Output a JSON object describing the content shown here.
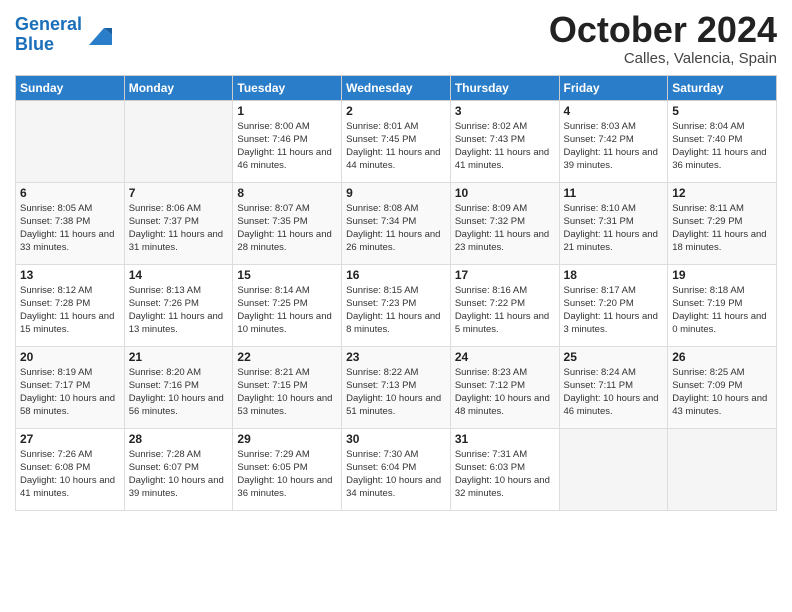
{
  "header": {
    "logo_line1": "General",
    "logo_line2": "Blue",
    "month": "October 2024",
    "location": "Calles, Valencia, Spain"
  },
  "days_of_week": [
    "Sunday",
    "Monday",
    "Tuesday",
    "Wednesday",
    "Thursday",
    "Friday",
    "Saturday"
  ],
  "weeks": [
    [
      {
        "day": "",
        "info": ""
      },
      {
        "day": "",
        "info": ""
      },
      {
        "day": "1",
        "info": "Sunrise: 8:00 AM\nSunset: 7:46 PM\nDaylight: 11 hours and 46 minutes."
      },
      {
        "day": "2",
        "info": "Sunrise: 8:01 AM\nSunset: 7:45 PM\nDaylight: 11 hours and 44 minutes."
      },
      {
        "day": "3",
        "info": "Sunrise: 8:02 AM\nSunset: 7:43 PM\nDaylight: 11 hours and 41 minutes."
      },
      {
        "day": "4",
        "info": "Sunrise: 8:03 AM\nSunset: 7:42 PM\nDaylight: 11 hours and 39 minutes."
      },
      {
        "day": "5",
        "info": "Sunrise: 8:04 AM\nSunset: 7:40 PM\nDaylight: 11 hours and 36 minutes."
      }
    ],
    [
      {
        "day": "6",
        "info": "Sunrise: 8:05 AM\nSunset: 7:38 PM\nDaylight: 11 hours and 33 minutes."
      },
      {
        "day": "7",
        "info": "Sunrise: 8:06 AM\nSunset: 7:37 PM\nDaylight: 11 hours and 31 minutes."
      },
      {
        "day": "8",
        "info": "Sunrise: 8:07 AM\nSunset: 7:35 PM\nDaylight: 11 hours and 28 minutes."
      },
      {
        "day": "9",
        "info": "Sunrise: 8:08 AM\nSunset: 7:34 PM\nDaylight: 11 hours and 26 minutes."
      },
      {
        "day": "10",
        "info": "Sunrise: 8:09 AM\nSunset: 7:32 PM\nDaylight: 11 hours and 23 minutes."
      },
      {
        "day": "11",
        "info": "Sunrise: 8:10 AM\nSunset: 7:31 PM\nDaylight: 11 hours and 21 minutes."
      },
      {
        "day": "12",
        "info": "Sunrise: 8:11 AM\nSunset: 7:29 PM\nDaylight: 11 hours and 18 minutes."
      }
    ],
    [
      {
        "day": "13",
        "info": "Sunrise: 8:12 AM\nSunset: 7:28 PM\nDaylight: 11 hours and 15 minutes."
      },
      {
        "day": "14",
        "info": "Sunrise: 8:13 AM\nSunset: 7:26 PM\nDaylight: 11 hours and 13 minutes."
      },
      {
        "day": "15",
        "info": "Sunrise: 8:14 AM\nSunset: 7:25 PM\nDaylight: 11 hours and 10 minutes."
      },
      {
        "day": "16",
        "info": "Sunrise: 8:15 AM\nSunset: 7:23 PM\nDaylight: 11 hours and 8 minutes."
      },
      {
        "day": "17",
        "info": "Sunrise: 8:16 AM\nSunset: 7:22 PM\nDaylight: 11 hours and 5 minutes."
      },
      {
        "day": "18",
        "info": "Sunrise: 8:17 AM\nSunset: 7:20 PM\nDaylight: 11 hours and 3 minutes."
      },
      {
        "day": "19",
        "info": "Sunrise: 8:18 AM\nSunset: 7:19 PM\nDaylight: 11 hours and 0 minutes."
      }
    ],
    [
      {
        "day": "20",
        "info": "Sunrise: 8:19 AM\nSunset: 7:17 PM\nDaylight: 10 hours and 58 minutes."
      },
      {
        "day": "21",
        "info": "Sunrise: 8:20 AM\nSunset: 7:16 PM\nDaylight: 10 hours and 56 minutes."
      },
      {
        "day": "22",
        "info": "Sunrise: 8:21 AM\nSunset: 7:15 PM\nDaylight: 10 hours and 53 minutes."
      },
      {
        "day": "23",
        "info": "Sunrise: 8:22 AM\nSunset: 7:13 PM\nDaylight: 10 hours and 51 minutes."
      },
      {
        "day": "24",
        "info": "Sunrise: 8:23 AM\nSunset: 7:12 PM\nDaylight: 10 hours and 48 minutes."
      },
      {
        "day": "25",
        "info": "Sunrise: 8:24 AM\nSunset: 7:11 PM\nDaylight: 10 hours and 46 minutes."
      },
      {
        "day": "26",
        "info": "Sunrise: 8:25 AM\nSunset: 7:09 PM\nDaylight: 10 hours and 43 minutes."
      }
    ],
    [
      {
        "day": "27",
        "info": "Sunrise: 7:26 AM\nSunset: 6:08 PM\nDaylight: 10 hours and 41 minutes."
      },
      {
        "day": "28",
        "info": "Sunrise: 7:28 AM\nSunset: 6:07 PM\nDaylight: 10 hours and 39 minutes."
      },
      {
        "day": "29",
        "info": "Sunrise: 7:29 AM\nSunset: 6:05 PM\nDaylight: 10 hours and 36 minutes."
      },
      {
        "day": "30",
        "info": "Sunrise: 7:30 AM\nSunset: 6:04 PM\nDaylight: 10 hours and 34 minutes."
      },
      {
        "day": "31",
        "info": "Sunrise: 7:31 AM\nSunset: 6:03 PM\nDaylight: 10 hours and 32 minutes."
      },
      {
        "day": "",
        "info": ""
      },
      {
        "day": "",
        "info": ""
      }
    ]
  ]
}
